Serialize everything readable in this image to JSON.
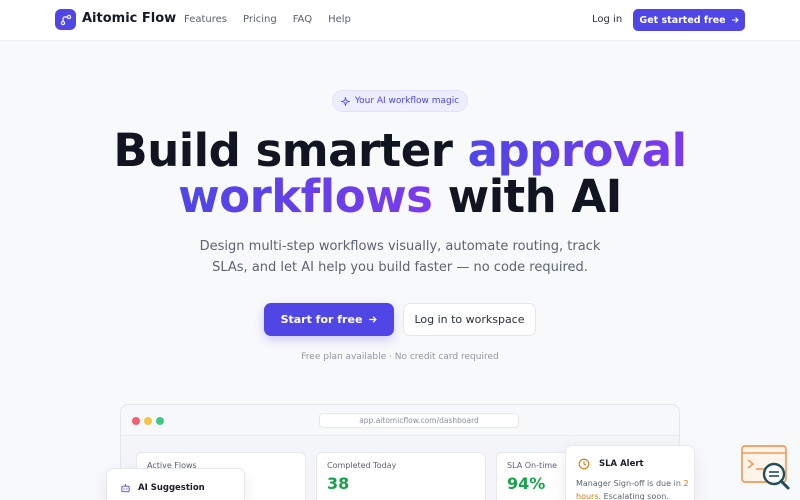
{
  "nav": {
    "brand": "Aitomic Flow",
    "links": [
      "Features",
      "Pricing",
      "FAQ",
      "Help"
    ],
    "login": "Log in",
    "cta": "Get started free"
  },
  "hero": {
    "badge": "Your AI workflow magic",
    "headline_part1": "Build smarter ",
    "headline_accent1": "approval",
    "headline_accent2": "workflows",
    "headline_part2": " with AI",
    "subhead": "Design multi-step workflows visually, automate routing, track SLAs, and let AI help you build faster — no code required.",
    "primary_cta": "Start for free",
    "secondary_cta": "Log in to workspace",
    "fineprint": "Free plan available · No credit card required"
  },
  "dashboard": {
    "url": "app.aitomicflow.com/dashboard",
    "cards": [
      {
        "label": "Active Flows",
        "value": ""
      },
      {
        "label": "Completed Today",
        "value": "38"
      },
      {
        "label": "SLA On-time",
        "value": "94%"
      }
    ],
    "ai_suggestion": {
      "title": "AI Suggestion"
    },
    "sla_alert": {
      "title": "SLA Alert",
      "text_before": "Manager Sign-off is due in ",
      "text_highlight": "2 hours",
      "text_after": ". Escalating soon."
    }
  },
  "colors": {
    "accent": "#4f46e5",
    "accent_alt": "#7c3aed",
    "success": "#16a34a",
    "warning": "#d97706"
  },
  "icons": {
    "logo": "flow-nodes-icon",
    "badge": "sparkle-icon",
    "arrow": "arrow-right-icon",
    "ai": "bot-icon",
    "alert": "clock-icon"
  }
}
